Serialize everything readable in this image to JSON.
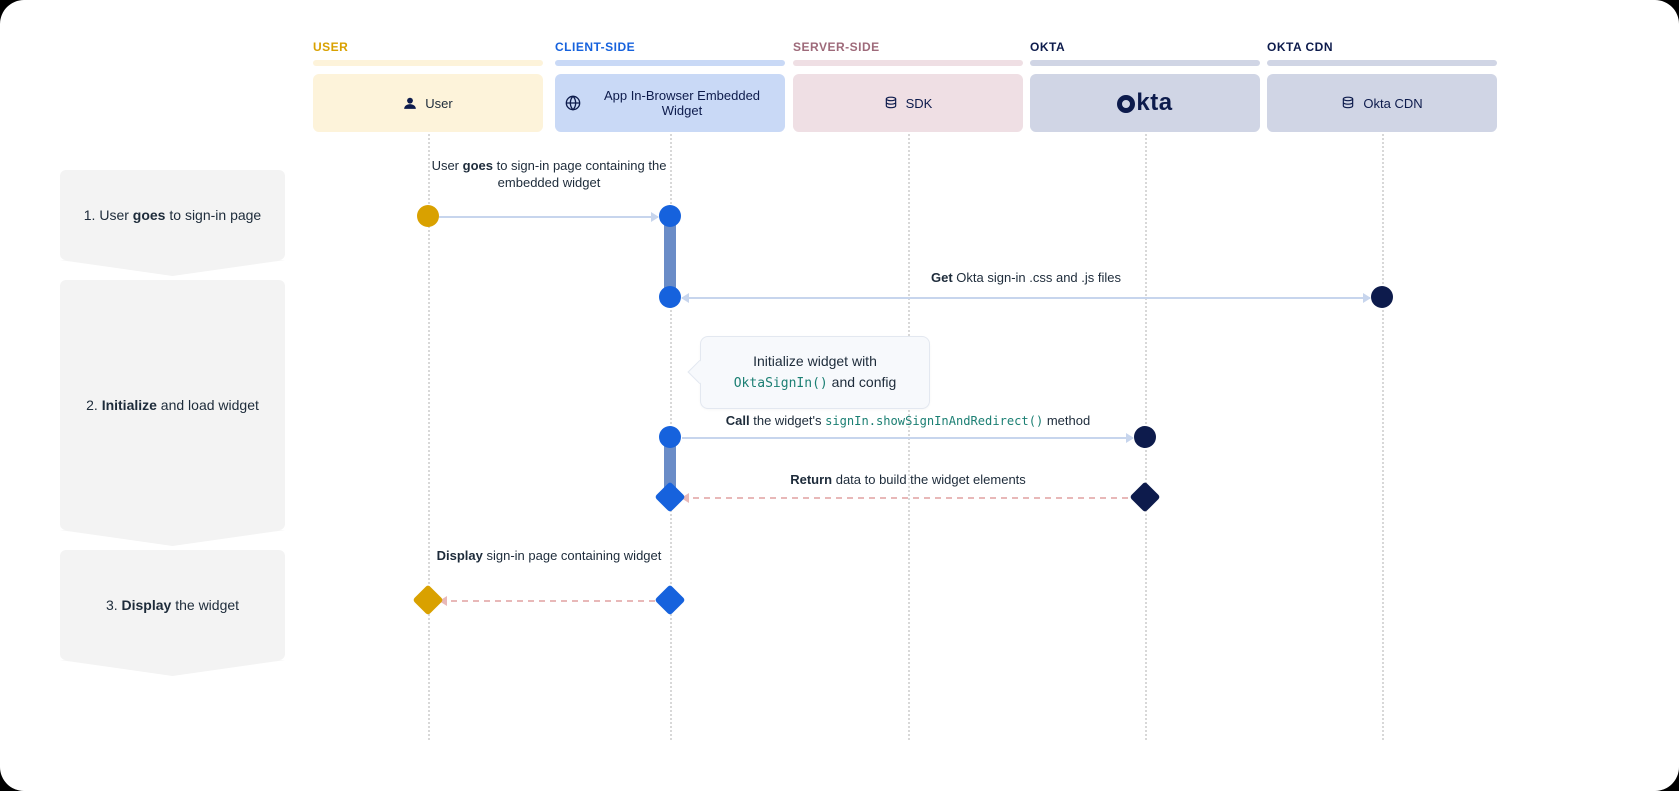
{
  "lanes": {
    "user": {
      "title": "USER",
      "box": "User"
    },
    "client": {
      "title": "CLIENT-SIDE",
      "box": "App In-Browser Embedded Widget"
    },
    "server": {
      "title": "SERVER-SIDE",
      "box": "SDK"
    },
    "okta": {
      "title": "OKTA",
      "box": "okta"
    },
    "cdn": {
      "title": "OKTA CDN",
      "box": "Okta CDN"
    }
  },
  "steps": {
    "s1": {
      "num": "1. ",
      "pre": "User ",
      "bold": "goes",
      "post": " to sign-in page"
    },
    "s2": {
      "num": "2. ",
      "bold": "Initialize",
      "post": " and load widget"
    },
    "s3": {
      "num": "3. ",
      "bold": "Display",
      "post": " the widget"
    }
  },
  "msgs": {
    "m1": {
      "pre": "User ",
      "bold": "goes",
      "post": " to sign-in page containing the embedded widget"
    },
    "m2": {
      "bold": "Get",
      "post": " Okta sign-in .css and .js files"
    },
    "m3": {
      "pre": "Initialize widget with ",
      "code": "OktaSignIn()",
      "post": " and config"
    },
    "m4": {
      "bold": "Call",
      "post1": " the widget's ",
      "code": "signIn.showSignInAndRedirect()",
      "post2": " method"
    },
    "m5": {
      "bold": "Return",
      "post": " data to build the widget elements"
    },
    "m6": {
      "bold": "Display",
      "post": " sign-in page containing widget"
    }
  }
}
